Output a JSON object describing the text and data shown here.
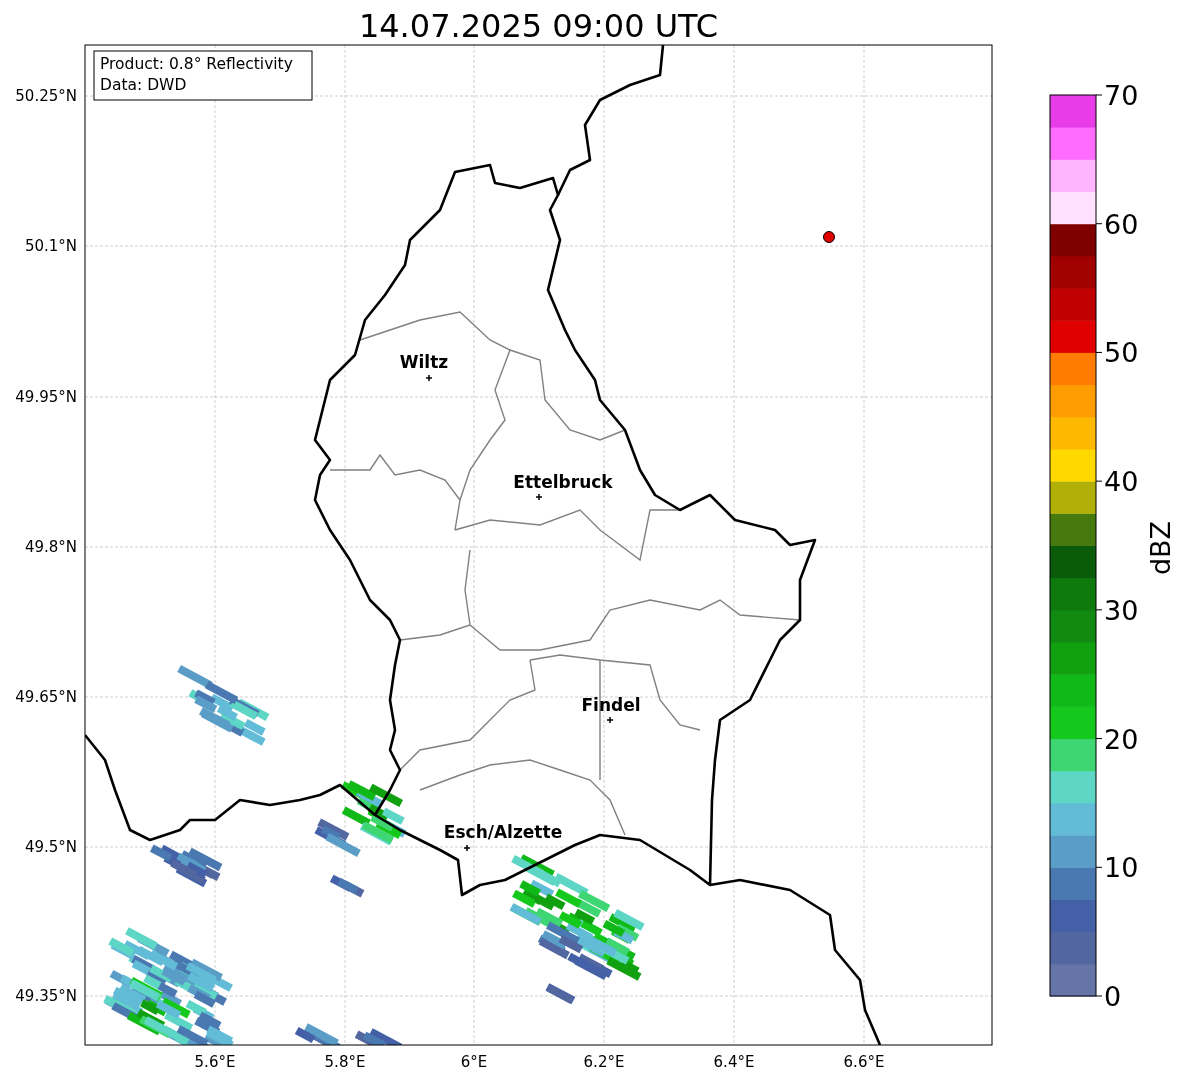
{
  "title": "14.07.2025 09:00 UTC",
  "info_box": [
    "Product: 0.8° Reflectivity",
    "Data: DWD"
  ],
  "map": {
    "yticks": [
      "50.25°N",
      "50.1°N",
      "49.95°N",
      "49.8°N",
      "49.65°N",
      "49.5°N",
      "49.35°N"
    ],
    "xticks": [
      "5.6°E",
      "5.8°E",
      "6°E",
      "6.2°E",
      "6.4°E",
      "6.6°E"
    ],
    "cities": [
      {
        "name": "Wiltz"
      },
      {
        "name": "Ettelbruck"
      },
      {
        "name": "Findel"
      },
      {
        "name": "Esch/Alzette"
      }
    ]
  },
  "colorbar": {
    "label": "dBZ",
    "ticks": [
      "70",
      "60",
      "50",
      "40",
      "30",
      "20",
      "10",
      "0"
    ]
  }
}
